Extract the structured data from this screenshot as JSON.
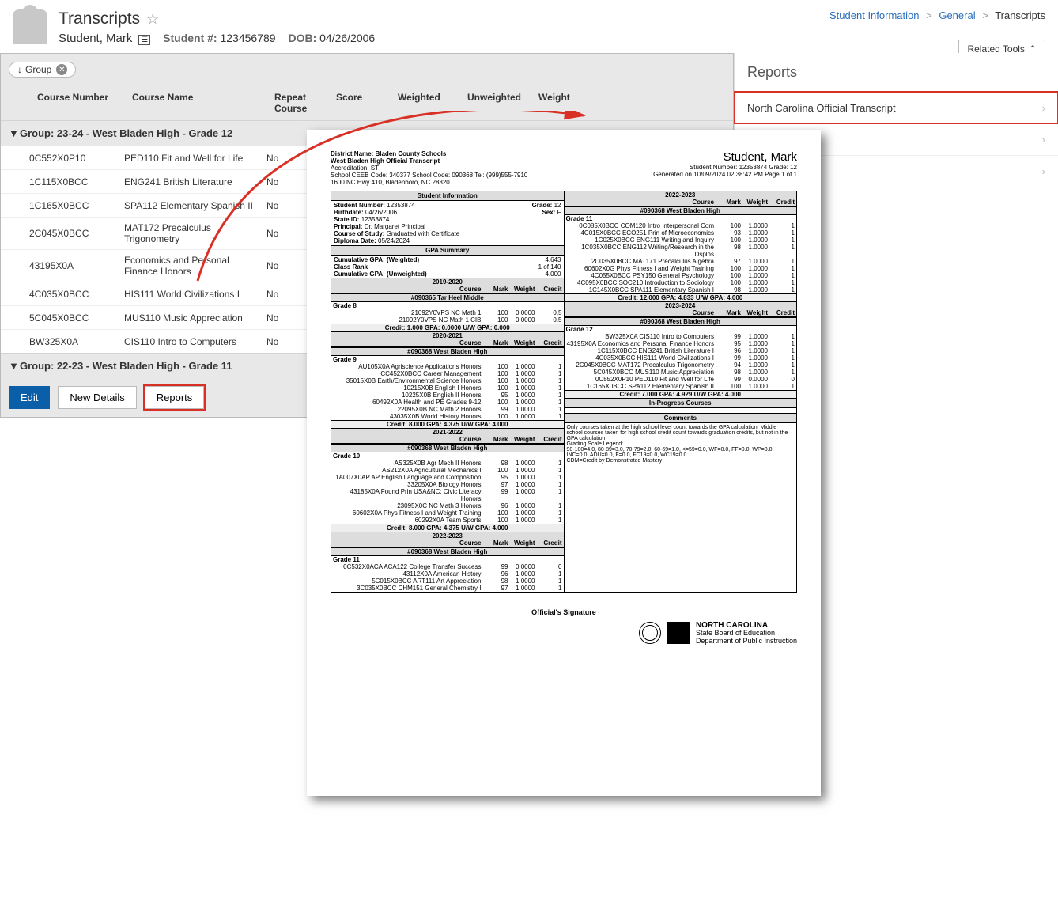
{
  "header": {
    "title": "Transcripts",
    "student_name": "Student, Mark",
    "student_num_label": "Student #:",
    "student_num": "123456789",
    "dob_label": "DOB:",
    "dob": "04/26/2006"
  },
  "breadcrumb": {
    "a": "Student Information",
    "b": "General",
    "c": "Transcripts"
  },
  "related_tools": "Related Tools",
  "group_pill": "Group",
  "grid_headers": {
    "course_number": "Course Number",
    "course_name": "Course Name",
    "repeat": "Repeat Course",
    "score": "Score",
    "weighted": "Weighted",
    "unweighted": "Unweighted",
    "weight": "Weight"
  },
  "group1": "Group: 23-24 - West Bladen High - Grade 12",
  "group2": "Group: 22-23 - West Bladen High - Grade 11",
  "rows": [
    {
      "num": "0C552X0P10",
      "name": "PED110 Fit and Well for Life",
      "repeat": "No"
    },
    {
      "num": "1C115X0BCC",
      "name": "ENG241 British Literature",
      "repeat": "No"
    },
    {
      "num": "1C165X0BCC",
      "name": "SPA112 Elementary Spanish II",
      "repeat": "No"
    },
    {
      "num": "2C045X0BCC",
      "name": "MAT172 Precalculus Trigonometry",
      "repeat": "No"
    },
    {
      "num": "43195X0A",
      "name": "Economics and Personal Finance Honors",
      "repeat": "No"
    },
    {
      "num": "4C035X0BCC",
      "name": "HIS111 World Civilizations I",
      "repeat": "No"
    },
    {
      "num": "5C045X0BCC",
      "name": "MUS110 Music Appreciation",
      "repeat": "No"
    },
    {
      "num": "BW325X0A",
      "name": "CIS110 Intro to Computers",
      "repeat": "No"
    }
  ],
  "buttons": {
    "edit": "Edit",
    "new_details": "New Details",
    "reports": "Reports"
  },
  "reports": {
    "title": "Reports",
    "item": "North Carolina Official Transcript"
  },
  "transcript": {
    "district_label": "District Name:",
    "district": "Bladen County Schools",
    "subtitle": "West Bladen High Official Transcript",
    "accred": "Accreditation:  ST",
    "ceeb": "School CEEB Code: 340377   School Code: 090368   Tel: (999)555-7910",
    "addr": "1600 NC Hwy 410,  Bladenboro, NC 28320",
    "stud_name": "Student, Mark",
    "stud_line": "Student Number: 12353874    Grade: 12",
    "gen": "Generated on 10/09/2024 02:38:42 PM  Page 1 of 1",
    "si_header": "Student Information",
    "si": {
      "sn_l": "Student Number:",
      "sn": "12353874",
      "grade_l": "Grade:",
      "grade": "12",
      "bd_l": "Birthdate:",
      "bd": "04/26/2006",
      "sex_l": "Sex:",
      "sex": "F",
      "sid_l": "State ID:",
      "sid": "12353874",
      "prin_l": "Principal:",
      "prin": "Dr. Margaret Principal",
      "cos_l": "Course of Study:",
      "cos": "Graduated with Certificate",
      "dd_l": "Diploma Date:",
      "dd": "05/24/2024"
    },
    "gpa_header": "GPA Summary",
    "gpa": {
      "cw_l": "Cumulative GPA: (Weighted)",
      "cw": "4.643",
      "cr_l": "Class Rank",
      "cr": "1 of 140",
      "cu_l": "Cumulative GPA: (Unweighted)",
      "cu": "4.000"
    },
    "col_course": "Course",
    "col_mark": "Mark",
    "col_weight": "Weight",
    "col_credit": "Credit",
    "y19": "2019-2020",
    "y20": "2020-2021",
    "y21": "2021-2022",
    "y22": "2022-2023",
    "y23": "2023-2024",
    "sch_tarheel": "#090365 Tar Heel Middle",
    "sch_wbladen": "#090368 West Bladen High",
    "g8": "Grade 8",
    "g9": "Grade 9",
    "g10": "Grade 10",
    "g11": "Grade 11",
    "g12": "Grade 12",
    "left_19": [
      {
        "c": "21092Y0VPS NC Math 1",
        "m": "100",
        "w": "0.0000",
        "cr": "0.5"
      },
      {
        "c": "21092Y0VPS NC Math 1 CIB",
        "m": "100",
        "w": "0.0000",
        "cr": "0.5"
      }
    ],
    "foot19": "Credit: 1.000  GPA: 0.0000  U/W GPA: 0.000",
    "left_20": [
      {
        "c": "AU105X0A Agriscience Applications Honors",
        "m": "100",
        "w": "1.0000",
        "cr": "1"
      },
      {
        "c": "CC452X0BCC Career Management",
        "m": "100",
        "w": "1.0000",
        "cr": "1"
      },
      {
        "c": "35015X0B Earth/Environmental Science Honors",
        "m": "100",
        "w": "1.0000",
        "cr": "1"
      },
      {
        "c": "10215X0B English I Honors",
        "m": "100",
        "w": "1.0000",
        "cr": "1"
      },
      {
        "c": "10225X0B English II Honors",
        "m": "95",
        "w": "1.0000",
        "cr": "1"
      },
      {
        "c": "60492X0A Health and PE Grades 9-12",
        "m": "100",
        "w": "1.0000",
        "cr": "1"
      },
      {
        "c": "22095X0B NC Math 2 Honors",
        "m": "99",
        "w": "1.0000",
        "cr": "1"
      },
      {
        "c": "43035X0B World History Honors",
        "m": "100",
        "w": "1.0000",
        "cr": "1"
      }
    ],
    "foot20": "Credit: 8.000  GPA: 4.375  U/W GPA: 4.000",
    "left_21": [
      {
        "c": "AS325X0B Agr Mech II Honors",
        "m": "98",
        "w": "1.0000",
        "cr": "1"
      },
      {
        "c": "AS212X0A Agricultural Mechanics I",
        "m": "100",
        "w": "1.0000",
        "cr": "1"
      },
      {
        "c": "1A007X0AP AP English Language and Composition",
        "m": "95",
        "w": "1.0000",
        "cr": "1"
      },
      {
        "c": "33205X0A Biology Honors",
        "m": "97",
        "w": "1.0000",
        "cr": "1"
      },
      {
        "c": "43185X0A Found Prin USA&NC: Civic Literacy Honors",
        "m": "99",
        "w": "1.0000",
        "cr": "1"
      },
      {
        "c": "23095X0C NC Math 3 Honors",
        "m": "96",
        "w": "1.0000",
        "cr": "1"
      },
      {
        "c": "60602X0A Phys Fitness I and Weight Training",
        "m": "100",
        "w": "1.0000",
        "cr": "1"
      },
      {
        "c": "60292X0A Team Sports",
        "m": "100",
        "w": "1.0000",
        "cr": "1"
      }
    ],
    "foot21": "Credit: 8.000  GPA: 4.375  U/W GPA: 4.000",
    "left_22": [
      {
        "c": "0C532X0ACA ACA122 College Transfer Success",
        "m": "99",
        "w": "0.0000",
        "cr": "0"
      },
      {
        "c": "43112X0A American History",
        "m": "96",
        "w": "1.0000",
        "cr": "1"
      },
      {
        "c": "5C015X0BCC ART111 Art Appreciation",
        "m": "98",
        "w": "1.0000",
        "cr": "1"
      },
      {
        "c": "3C035X0BCC CHM151 General Chemistry I",
        "m": "97",
        "w": "1.0000",
        "cr": "1"
      }
    ],
    "right_22": [
      {
        "c": "0C085X0BCC COM120 Intro Interpersonal Com",
        "m": "100",
        "w": "1.0000",
        "cr": "1"
      },
      {
        "c": "4C015X0BCC ECO251 Prin of Microeconomics",
        "m": "93",
        "w": "1.0000",
        "cr": "1"
      },
      {
        "c": "1C025X0BCC ENG111 Writing and Inquiry",
        "m": "100",
        "w": "1.0000",
        "cr": "1"
      },
      {
        "c": "1C035X0BCC ENG112 Writing/Research in the Dsplns",
        "m": "98",
        "w": "1.0000",
        "cr": "1"
      },
      {
        "c": "2C035X0BCC MAT171 Precalculus Algebra",
        "m": "97",
        "w": "1.0000",
        "cr": "1"
      },
      {
        "c": "60602X0G Phys Fitness I and Weight Training",
        "m": "100",
        "w": "1.0000",
        "cr": "1"
      },
      {
        "c": "4C055X0BCC PSY150 General Psychology",
        "m": "100",
        "w": "1.0000",
        "cr": "1"
      },
      {
        "c": "4C095X0BCC SOC210 Introduction to Sociology",
        "m": "100",
        "w": "1.0000",
        "cr": "1"
      },
      {
        "c": "1C145X0BCC SPA111 Elementary Spanish I",
        "m": "98",
        "w": "1.0000",
        "cr": "1"
      }
    ],
    "foot22": "Credit: 12.000  GPA: 4.833  U/W GPA: 4.000",
    "right_23": [
      {
        "c": "BW325X0A CIS110 Intro to Computers",
        "m": "99",
        "w": "1.0000",
        "cr": "1"
      },
      {
        "c": "43195X0A Economics and Personal Finance Honors",
        "m": "95",
        "w": "1.0000",
        "cr": "1"
      },
      {
        "c": "1C115X0BCC ENG241 British Literature I",
        "m": "96",
        "w": "1.0000",
        "cr": "1"
      },
      {
        "c": "4C035X0BCC HIS111 World Civilizations I",
        "m": "99",
        "w": "1.0000",
        "cr": "1"
      },
      {
        "c": "2C045X0BCC MAT172 Precalculus Trigonometry",
        "m": "94",
        "w": "1.0000",
        "cr": "1"
      },
      {
        "c": "5C045X0BCC MUS110 Music Appreciation",
        "m": "98",
        "w": "1.0000",
        "cr": "1"
      },
      {
        "c": "0C552X0P10 PED110 Fit and Well for Life",
        "m": "99",
        "w": "0.0000",
        "cr": "0"
      },
      {
        "c": "1C165X0BCC SPA112 Elementary Spanish II",
        "m": "100",
        "w": "1.0000",
        "cr": "1"
      }
    ],
    "foot23": "Credit: 7.000  GPA: 4.929  U/W GPA: 4.000",
    "inprog": "In-Progress Courses",
    "comments_h": "Comments",
    "comments": "Only courses taken at the high school level count towards the GPA calculation. Middle school courses taken for high school credit count towards graduation credits, but not in the GPA calculation.\nGrading Scale Legend:\n90-100=4.0, 80-89=3.0, 70-79=2.0, 60-69=1.0, <=59=0.0, WF=0.0, FF=0.0, WP=0.0, INC=0.0, ADU=0.0, F=0.0, FC19=0.0, WC19=0.0\nCDM=Credit by Demonstrated Mastery",
    "sig": "Official's Signature",
    "nc": "NORTH CAROLINA",
    "nc2": "State Board of Education",
    "nc3": "Department of Public Instruction"
  }
}
